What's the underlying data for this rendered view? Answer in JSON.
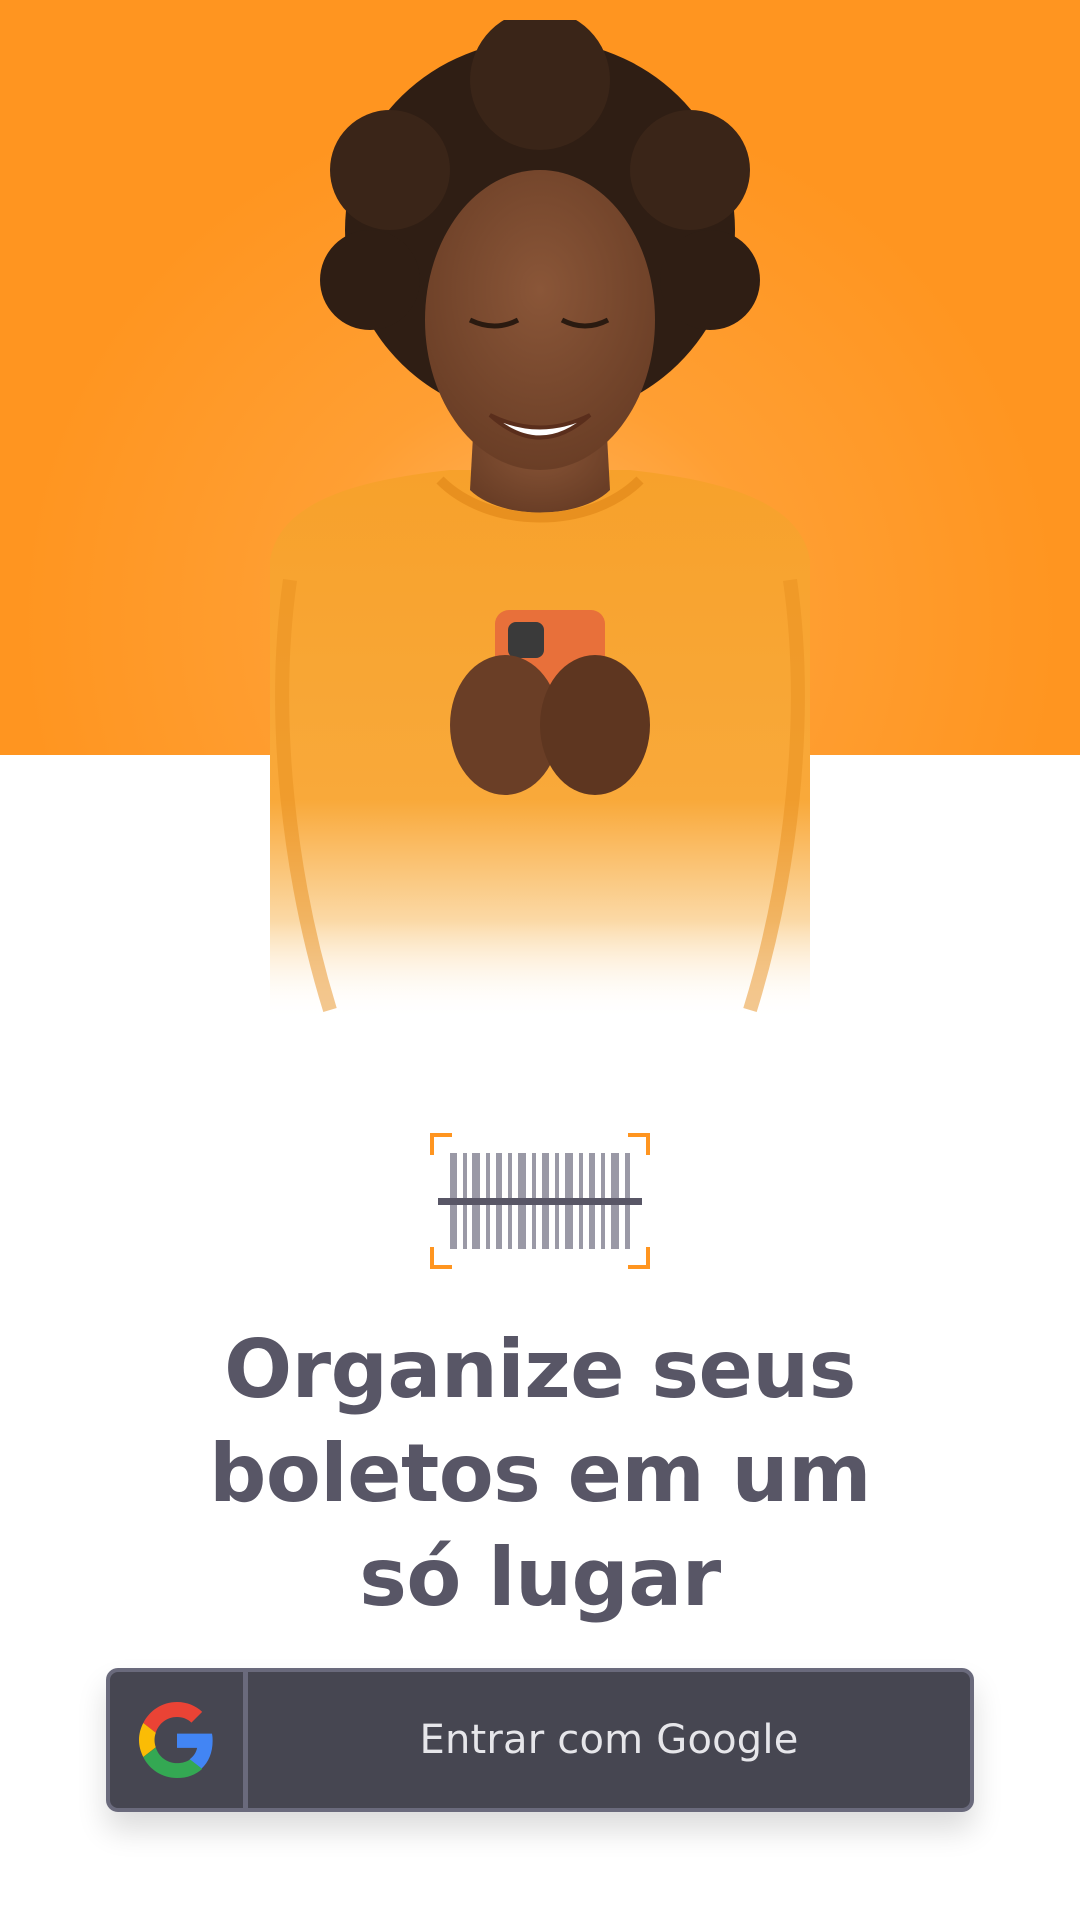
{
  "hero": {
    "background_color": "#FF9520",
    "illustration": "woman-smiling-holding-phone"
  },
  "logo": {
    "icon": "barcode-scan-icon",
    "accent_color": "#FF9520",
    "bar_color": "#585666"
  },
  "headline": {
    "line1": "Organize seus",
    "line2": "boletos em um",
    "line3": "só lugar",
    "color": "#585666"
  },
  "login": {
    "google_label": "Entrar com Google",
    "google_icon": "google-g-icon",
    "button_color": "#464651"
  }
}
